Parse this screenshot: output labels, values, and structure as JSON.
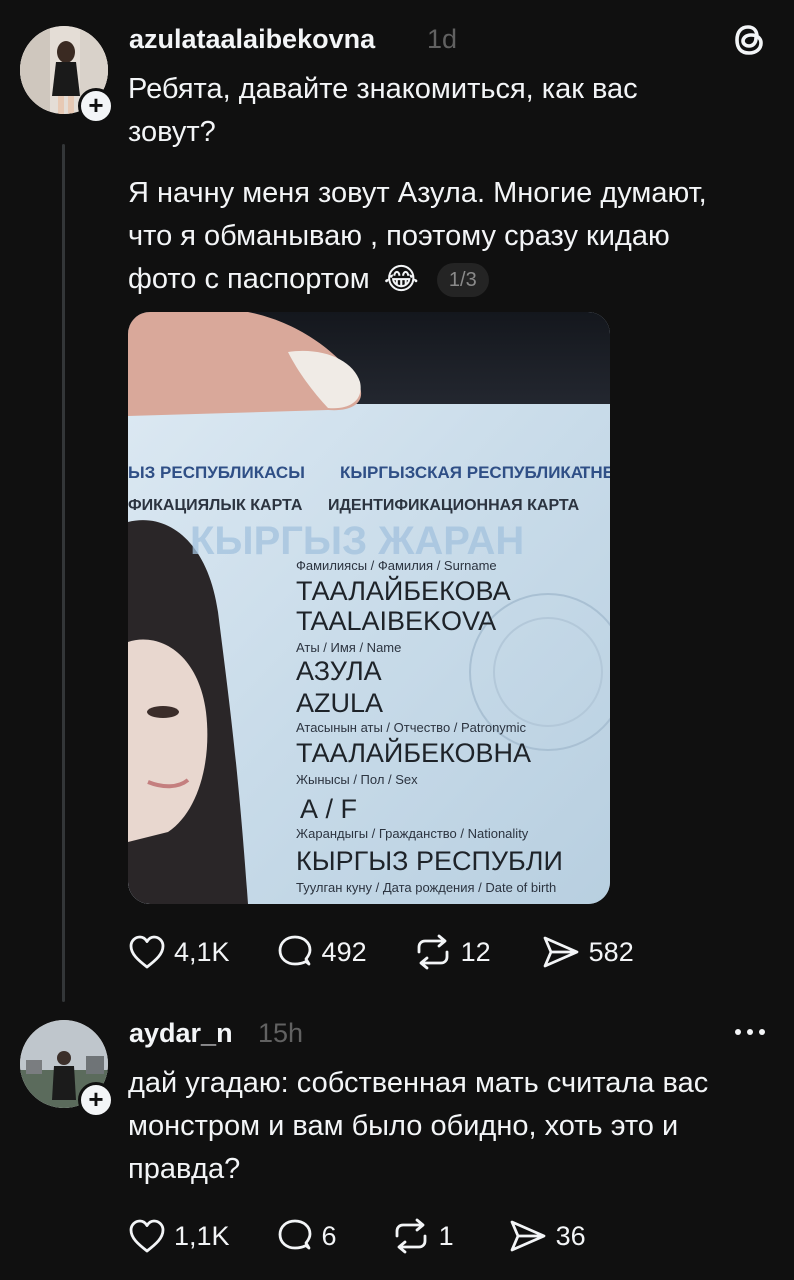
{
  "post": {
    "username": "azulataalaibekovna",
    "time": "1d",
    "text_line1": "Ребята, давайте знакомиться, как вас зовут?",
    "text_line2": "Я начну меня зовут Азула. Многие думают, что я обманываю , поэтому сразу кидаю фото с паспортом",
    "emoji": "😂",
    "media_counter": "1/3",
    "card": {
      "header_ky": "ЫЗ РЕСПУБЛИКАСЫ",
      "header_ru": "КЫРГЫЗСКАЯ РЕСПУБЛИКА",
      "header_en": "THE",
      "sub_ky": "ФИКАЦИЯЛЫК КАРТА",
      "sub_ru": "ИДЕНТИФИКАЦИОННАЯ КАРТА",
      "watermark": "КЫРГЫЗ ЖАРАН",
      "surname_label": "Фамилиясы / Фамилия / Surname",
      "surname_cyr": "ТААЛАЙБЕКОВА",
      "surname_lat": "TAALAIBEKOVA",
      "name_label": "Аты / Имя / Name",
      "name_cyr": "АЗУЛА",
      "name_lat": "AZULA",
      "patronymic_label": "Атасынын аты / Отчество / Patronymic",
      "patronymic": "ТААЛАЙБЕКОВНА",
      "sex_label": "Жынысы / Пол / Sex",
      "sex": "А / F",
      "nationality_label": "Жарандыгы / Гражданство / Nationality",
      "nationality": "КЫРГЫЗ РЕСПУБЛИ",
      "dob_label": "Туулган куну / Дата рождения / Date of birth"
    },
    "likes": "4,1K",
    "replies": "492",
    "reposts": "12",
    "shares": "582"
  },
  "reply": {
    "username": "aydar_n",
    "time": "15h",
    "text": "дай угадаю: собственная мать считала вас монстром и вам было обидно, хоть это и правда?",
    "likes": "1,1K",
    "replies": "6",
    "reposts": "1",
    "shares": "36"
  },
  "icons": {
    "like": "heart-icon",
    "reply": "comment-icon",
    "repost": "repost-icon",
    "share": "send-icon",
    "more": "more-icon",
    "app": "threads-logo-icon"
  },
  "colors": {
    "background": "#101010",
    "text": "#f3f5f7",
    "muted": "#616161"
  }
}
